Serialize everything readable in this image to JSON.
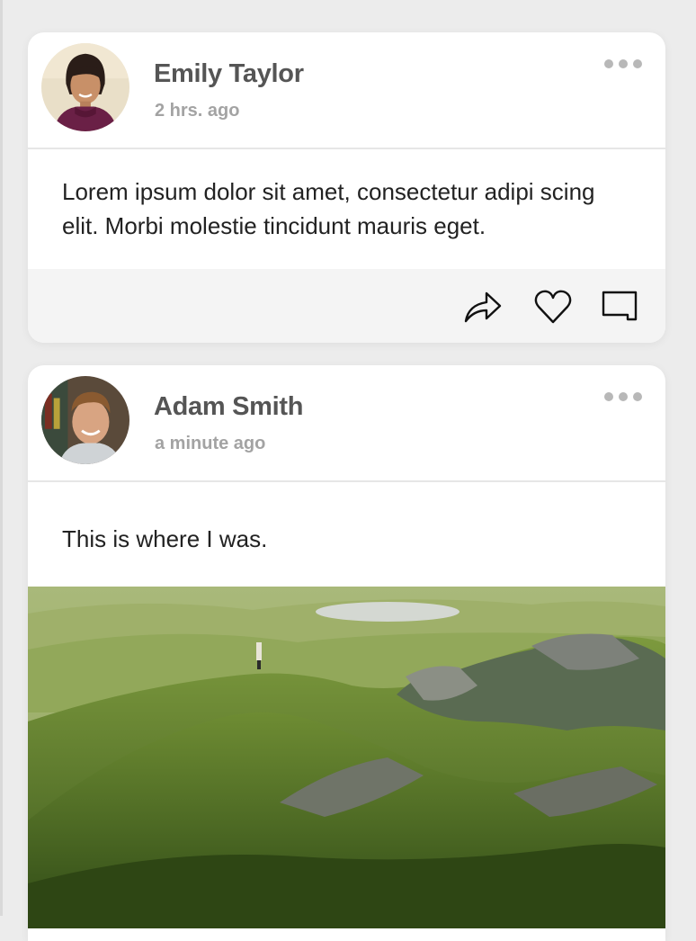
{
  "posts": [
    {
      "author": "Emily Taylor",
      "time": "2 hrs. ago",
      "text": "Lorem ipsum dolor sit amet, consectetur adipi scing elit. Morbi molestie tincidunt mauris eget.",
      "avatar_icon": "woman-portrait",
      "actions": [
        "share-icon",
        "heart-icon",
        "comment-icon"
      ],
      "menu_icon": "more-dots-icon"
    },
    {
      "author": "Adam Smith",
      "time": "a minute ago",
      "text": "This is where I was.",
      "avatar_icon": "man-portrait",
      "menu_icon": "more-dots-icon",
      "image": "green-hills-landscape-photo"
    }
  ],
  "colors": {
    "background": "#ececec",
    "card": "#ffffff",
    "action_bar": "#f4f4f4",
    "author_name": "#555555",
    "timestamp": "#a3a3a3",
    "post_text": "#222222"
  }
}
